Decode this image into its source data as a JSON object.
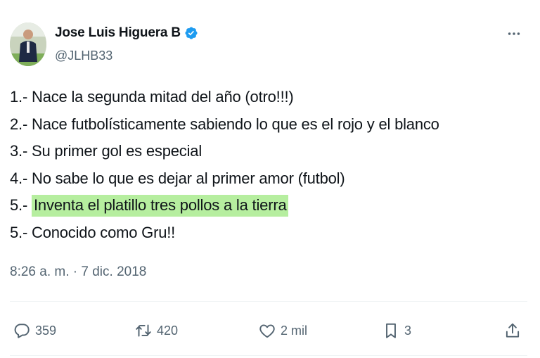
{
  "author": {
    "name": "Jose Luis Higuera B",
    "handle": "@JLHB33",
    "verified": true
  },
  "tweet": {
    "lines": [
      {
        "num": "1.- ",
        "text": "Nace la segunda mitad del año (otro!!!)",
        "highlighted": false
      },
      {
        "num": "2.- ",
        "text": "Nace futbolísticamente sabiendo lo que es el rojo y el blanco",
        "highlighted": false
      },
      {
        "num": "3.- ",
        "text": "Su primer gol es especial",
        "highlighted": false
      },
      {
        "num": "4.- ",
        "text": "No sabe lo que es dejar al primer amor (futbol)",
        "highlighted": false
      },
      {
        "num": "5.- ",
        "text": "Inventa el platillo tres pollos a la tierra",
        "highlighted": true
      },
      {
        "num": "5.- ",
        "text": "Conocido como Gru!!",
        "highlighted": false
      }
    ],
    "timestamp": "8:26 a. m. · 7 dic. 2018"
  },
  "actions": {
    "replies": "359",
    "retweets": "420",
    "likes": "2 mil",
    "bookmarks": "3"
  },
  "colors": {
    "text": "#0f1419",
    "secondary": "#536471",
    "verified": "#1d9bf0",
    "highlight": "#b6ee9f"
  },
  "icons": [
    "more-icon",
    "verified-badge-icon",
    "reply-icon",
    "retweet-icon",
    "like-icon",
    "bookmark-icon",
    "share-icon"
  ]
}
